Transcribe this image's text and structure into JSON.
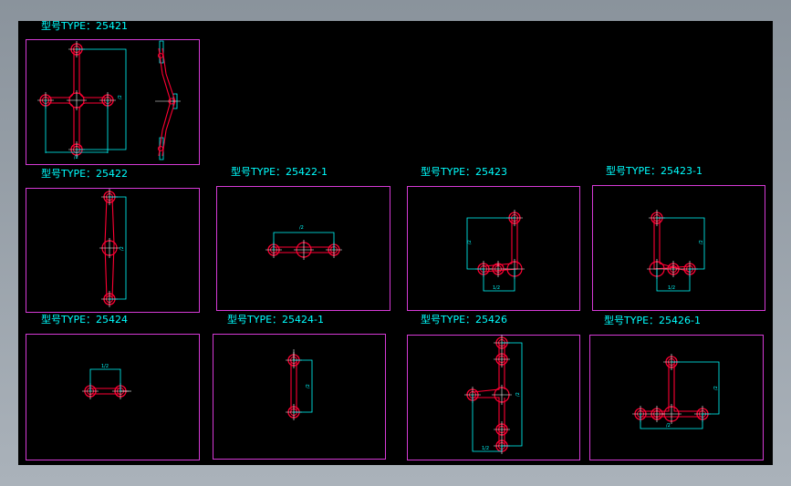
{
  "drawings": [
    {
      "id": "25421",
      "label": "型号TYPE：25421"
    },
    {
      "id": "25422",
      "label": "型号TYPE：25422"
    },
    {
      "id": "25422-1",
      "label": "型号TYPE：25422-1"
    },
    {
      "id": "25423",
      "label": "型号TYPE：25423"
    },
    {
      "id": "25423-1",
      "label": "型号TYPE：25423-1"
    },
    {
      "id": "25424",
      "label": "型号TYPE：25424"
    },
    {
      "id": "25424-1",
      "label": "型号TYPE：25424-1"
    },
    {
      "id": "25426",
      "label": "型号TYPE：25426"
    },
    {
      "id": "25426-1",
      "label": "型号TYPE：25426-1"
    }
  ],
  "dims": {
    "full": "/2",
    "half": "1/2",
    "full_short": "/2"
  },
  "colors": {
    "background": "#000000",
    "frame": "#d63ad6",
    "text": "#00ffff",
    "part": "#ff0033",
    "dimension": "#00ffff",
    "centerline": "#ffffff"
  }
}
